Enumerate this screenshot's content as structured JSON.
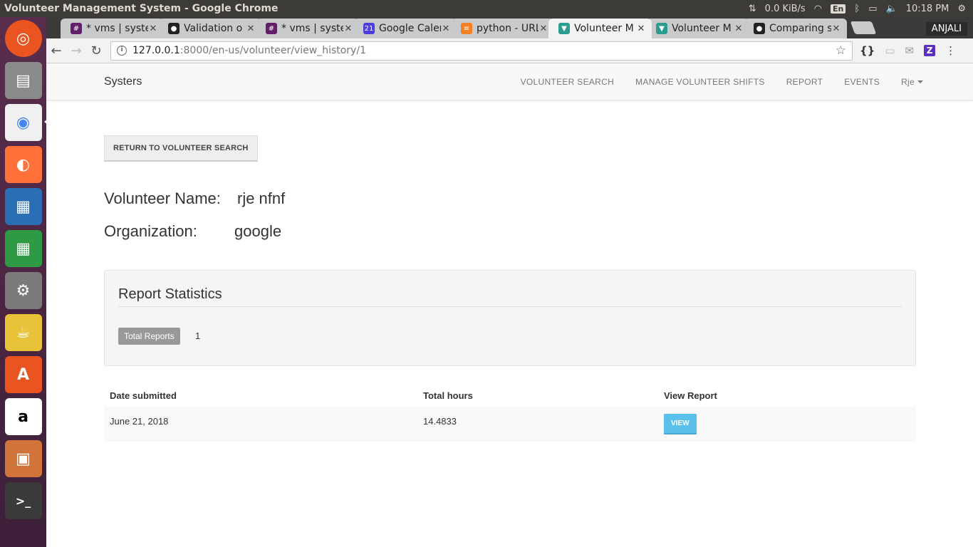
{
  "os": {
    "window_title": "Volunteer Management System - Google Chrome",
    "net_speed": "0.0 KiB/s",
    "lang": "En",
    "time": "10:18 PM"
  },
  "browser": {
    "tabs": [
      {
        "label": "* vms | syste",
        "icon": "slack-icon",
        "color": "#611f69"
      },
      {
        "label": "Validation o",
        "icon": "github-icon",
        "color": "#222222"
      },
      {
        "label": "* vms | syste",
        "icon": "slack-icon",
        "color": "#611f69"
      },
      {
        "label": "Google Caler",
        "icon": "calendar-icon",
        "color": "#4b3fdc"
      },
      {
        "label": "python - URL",
        "icon": "stackoverflow-icon",
        "color": "#f48024"
      },
      {
        "label": "Volunteer M",
        "icon": "vms-icon",
        "color": "#2a9d8f"
      },
      {
        "label": "Volunteer M",
        "icon": "vms-icon",
        "color": "#2a9d8f"
      },
      {
        "label": "Comparing s",
        "icon": "github-icon",
        "color": "#222222"
      }
    ],
    "profile": "ANJALI",
    "url_host": "127.0.0.1",
    "url_path": ":8000/en-us/volunteer/view_history/1"
  },
  "app": {
    "brand": "Systers",
    "nav": [
      "VOLUNTEER SEARCH",
      "MANAGE VOLUNTEER SHIFTS",
      "REPORT",
      "EVENTS"
    ],
    "user_menu": "Rje"
  },
  "main": {
    "return_button": "RETURN TO VOLUNTEER SEARCH",
    "volunteer_name_label": "Volunteer Name:",
    "volunteer_name": "rje nfnf",
    "organization_label": "Organization:",
    "organization": "google",
    "stats_title": "Report Statistics",
    "total_reports_label": "Total Reports",
    "total_reports_value": "1",
    "table": {
      "headers": [
        "Date submitted",
        "Total hours",
        "View Report"
      ],
      "rows": [
        {
          "date": "June 21, 2018",
          "hours": "14.4833",
          "action": "VIEW"
        }
      ]
    }
  }
}
